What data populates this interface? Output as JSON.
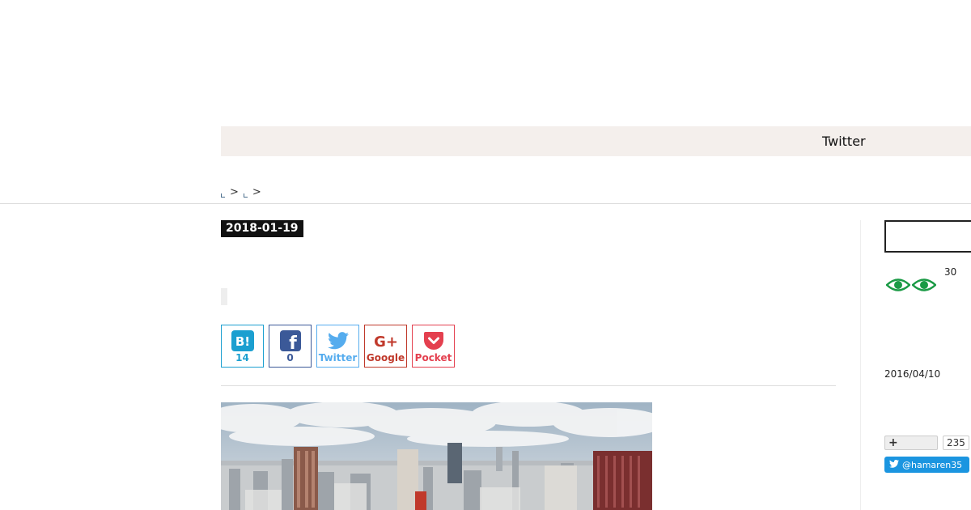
{
  "nav": {
    "twitter_label": "Twitter"
  },
  "breadcrumb": {
    "sep1": ">",
    "sep2": ">"
  },
  "article": {
    "date": "2018-01-19"
  },
  "share": {
    "hatena": {
      "icon_text": "B!",
      "count": "14"
    },
    "facebook": {
      "icon_text": "f",
      "count": "0"
    },
    "twitter": {
      "label": "Twitter"
    },
    "google": {
      "icon_text": "G+",
      "label": "Google"
    },
    "pocket": {
      "label": "Pocket"
    }
  },
  "sidebar": {
    "eye_count": "30",
    "date": "2016/04/10",
    "follow_count": "235",
    "twitter_handle": "@hamaren35",
    "follow_icon": "+"
  },
  "colors": {
    "hatena": "#1b9fd0",
    "facebook": "#3b5998",
    "twitter": "#55acee",
    "google": "#c0392b",
    "pocket": "#e4404f",
    "nav_bg": "#f4efec",
    "eye_green": "#1a9a45"
  }
}
